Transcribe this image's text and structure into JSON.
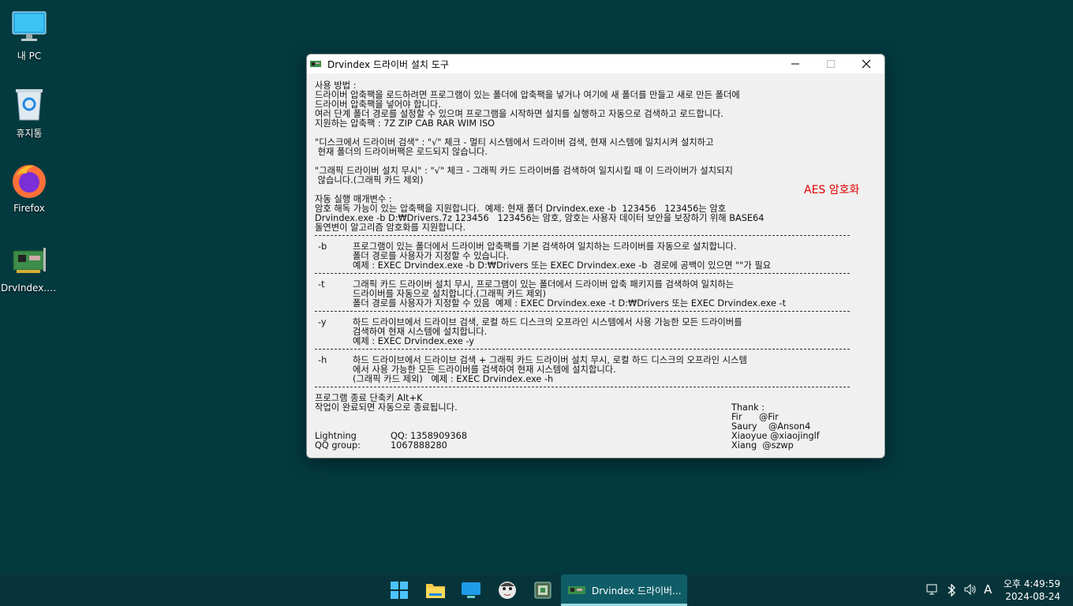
{
  "desktop": {
    "icons": [
      {
        "label": "내 PC",
        "icon": "monitor-icon"
      },
      {
        "label": "휴지통",
        "icon": "recycle-bin-icon"
      },
      {
        "label": "Firefox",
        "icon": "firefox-icon"
      },
      {
        "label": "DrvIndex.v...",
        "icon": "circuit-board-icon"
      }
    ]
  },
  "window": {
    "title": "Drvindex  드라이버 설치 도구",
    "aes_label": "AES 암호화",
    "usage": [
      "사용 방법 :",
      "드라이버 압축팩을 로드하려면 프로그램이 있는 폴더에 압축팩을 넣거나 여기에 새 폴더를 만들고 새로 만든 폴더에",
      "드라이버 압축팩을 넣어야 합니다.",
      "여러 단계 폴더 경로를 설정할 수 있으며 프로그램을 시작하면 설치를 실행하고 자동으로 검색하고 로드합니다.",
      "지원하는 압축팩 : 7Z ZIP CAB RAR WIM ISO"
    ],
    "disk_search": [
      "\"디스크에서 드라이버 검색\" : \"√\" 체크 - 멀티 시스템에서 드라이버 검색, 현재 시스템에 일치시켜 설치하고",
      " 현재 폴더의 드라이버팩은 로드되지 않습니다."
    ],
    "graphic_ignore": [
      "\"그래픽 드라이버 설치 무시\" : \"√\" 체크 - 그래픽 카드 드라이버를 검색하여 일치시킬 때 이 드라이버가 설치되지",
      " 않습니다.(그래픽 카드 제외)"
    ],
    "auto_params": [
      "자동 실행 매개변수 :",
      "암호 해독 가능이 있는 압축팩을 지원합니다.  예제: 현재 폴더 Drvindex.exe -b  123456   123456는 암호",
      "Drvindex.exe -b D:₩Drivers.7z 123456   123456는 암호, 암호는 사용자 데이터 보안을 보장하기 위해 BASE64",
      "돌연변이 알고리즘 암호화를 지원합니다."
    ],
    "options": [
      {
        "flag": "-b",
        "lines": [
          "프로그램이 있는 폴더에서 드라이버 압축팩를 기본 검색하여 일치하는 드라이버를 자동으로 설치합니다.",
          "폴더 경로를 사용자가 지정할 수 있습니다.",
          "예제 : EXEC Drvindex.exe -b D:₩Drivers 또는 EXEC Drvindex.exe -b  경로에 공백이 있으면 \"\"가 필요"
        ]
      },
      {
        "flag": "-t",
        "lines": [
          "그래픽 카드 드라이버 설치 무시, 프로그램이 있는 폴더에서 드라이버 압축 패키지를 검색하여 일치하는",
          "드라이버를 자동으로 설치합니다.(그래픽 카드 제외)",
          "폴더 경로를 사용자가 지정할 수 있음  예제 : EXEC Drvindex.exe -t D:₩Drivers 또는 EXEC Drvindex.exe -t"
        ]
      },
      {
        "flag": "-y",
        "lines": [
          "하드 드라이브에서 드라이브 검색, 로컬 하드 디스크의 오프라인 시스템에서 사용 가능한 모든 드라이버를",
          "검색하여 현재 시스템에 설치합니다.",
          "예제 : EXEC Drvindex.exe -y"
        ]
      },
      {
        "flag": "-h",
        "lines": [
          "하드 드라이브에서 드라이브 검색 + 그래픽 카드 드라이버 설치 무시, 로컬 하드 디스크의 오프라인 시스템",
          "에서 사용 가능한 모든 드라이버를 검색하여 현재 시스템에 설치합니다.",
          "(그래픽 카드 제외)   예제 : EXEC Drvindex.exe -h"
        ]
      }
    ],
    "footer": [
      "프로그램 종료 단축키 Alt+K",
      "작업이 완료되면 자동으로 종료됩니다."
    ],
    "contact": [
      {
        "name": "Lightning",
        "value": "QQ: 1358909368"
      },
      {
        "name": "QQ group:",
        "value": "1067888280"
      }
    ],
    "thanks": [
      "Thank :",
      "Fir      @Fir",
      "Saury    @Anson4",
      "Xiaoyue @xiaojinglf",
      "Xiang  @szwp"
    ]
  },
  "taskbar": {
    "pinned": [
      "windows-start-icon",
      "file-explorer-icon",
      "desktop-app-icon",
      "character-app-icon",
      "drvindex-app-icon"
    ],
    "active_label": "Drvindex  드라이버...",
    "ime": "A",
    "time": "오후 4:49:59",
    "date": "2024-08-24"
  }
}
